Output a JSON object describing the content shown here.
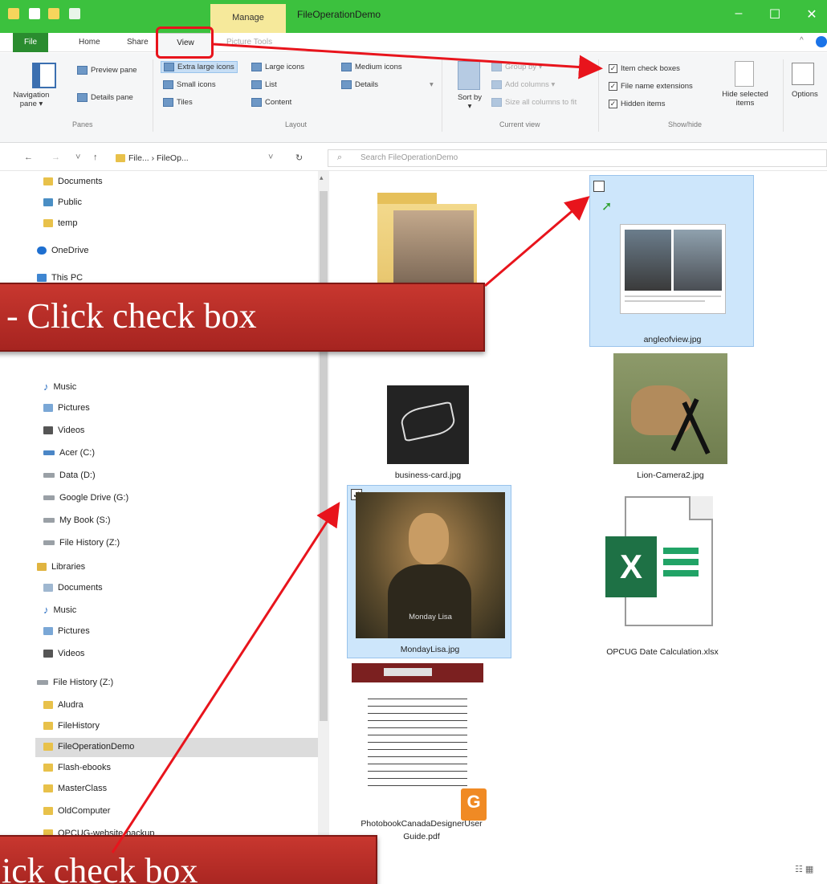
{
  "window": {
    "title": "FileOperationDemo",
    "context_tab": "Manage",
    "context_tab_group": "Picture Tools"
  },
  "tabs": {
    "file": "File",
    "home": "Home",
    "share": "Share",
    "view": "View"
  },
  "ribbon": {
    "panes": {
      "navigation_pane": "Navigation pane ▾",
      "preview_pane": "Preview pane",
      "details_pane": "Details pane",
      "group": "Panes"
    },
    "layout": {
      "extra_large": "Extra large icons",
      "large": "Large icons",
      "medium": "Medium icons",
      "small": "Small icons",
      "list": "List",
      "details": "Details",
      "tiles": "Tiles",
      "content": "Content",
      "group": "Layout"
    },
    "current_view": {
      "sort_by": "Sort by ▾",
      "group_by": "Group by ▾",
      "add_columns": "Add columns ▾",
      "size_all": "Size all columns to fit",
      "group": "Current view"
    },
    "show_hide": {
      "item_check_boxes": "Item check boxes",
      "file_name_extensions": "File name extensions",
      "hidden_items": "Hidden items",
      "hide_selected": "Hide selected items",
      "group": "Show/hide"
    },
    "options": "Options"
  },
  "address": {
    "path": "File... › FileOp...",
    "search_placeholder": "Search FileOperationDemo"
  },
  "nav_items": [
    "Documents",
    "Public",
    "temp",
    "OneDrive",
    "This PC",
    "Music",
    "Pictures",
    "Videos",
    "Acer (C:)",
    "Data (D:)",
    "Google Drive (G:)",
    "My Book (S:)",
    "File History (Z:)",
    "Libraries",
    "Documents",
    "Music",
    "Pictures",
    "Videos",
    "File History (Z:)",
    "Aludra",
    "FileHistory",
    "FileOperationDemo",
    "Flash-ebooks",
    "MasterClass",
    "OldComputer",
    "OPCUG-website-backup"
  ],
  "files": {
    "angleofview": "angleofview.jpg",
    "business_card": "business-card.jpg",
    "lion": "Lion-Camera2.jpg",
    "monalisa": "MondayLisa.jpg",
    "monalisa_overlay": "Monday Lisa",
    "excel": "OPCUG Date Calculation.xlsx",
    "pdf_line1": "PhotobookCanadaDesignerUser",
    "pdf_line2": "Guide.pdf"
  },
  "callouts": {
    "top": "- Click check box",
    "bottom": "ick check box"
  },
  "colors": {
    "accent": "#3cc13e",
    "callout": "#b52c26",
    "arrow": "#e8141c",
    "selection": "#cde6fb"
  }
}
